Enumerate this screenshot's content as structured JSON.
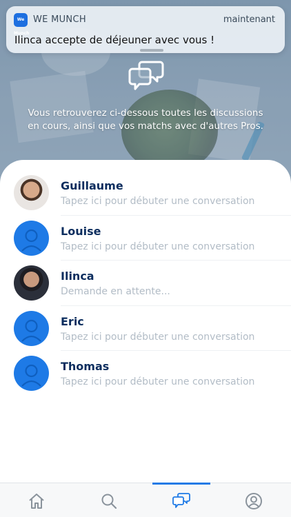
{
  "notification": {
    "app_name": "WE MUNCH",
    "app_icon_text": "We Munch",
    "time": "maintenant",
    "message": "Ilinca accepte de déjeuner avec vous !"
  },
  "hero": {
    "icon": "chat-bubbles-icon",
    "text": "Vous retrouverez ci-dessous toutes les discussions en cours, ainsi que vos matchs avec d'autres Pros."
  },
  "conversations": [
    {
      "name": "Guillaume",
      "subtitle": "Tapez ici pour débuter une conversation",
      "avatar": "photo"
    },
    {
      "name": "Louise",
      "subtitle": "Tapez ici pour débuter une conversation",
      "avatar": "default-user-icon"
    },
    {
      "name": "Ilinca",
      "subtitle": "Demande en attente...",
      "avatar": "photo"
    },
    {
      "name": "Eric",
      "subtitle": "Tapez ici pour débuter une conversation",
      "avatar": "default-user-icon"
    },
    {
      "name": "Thomas",
      "subtitle": "Tapez ici pour débuter une conversation",
      "avatar": "default-user-icon"
    }
  ],
  "tabbar": {
    "tabs": [
      {
        "icon": "home-icon",
        "active": false
      },
      {
        "icon": "search-icon",
        "active": false
      },
      {
        "icon": "chat-icon",
        "active": true
      },
      {
        "icon": "profile-icon",
        "active": false
      }
    ]
  },
  "colors": {
    "accent": "#1e7ae6",
    "name_text": "#0c2d5e",
    "subtitle_text": "#b2bcc6"
  }
}
